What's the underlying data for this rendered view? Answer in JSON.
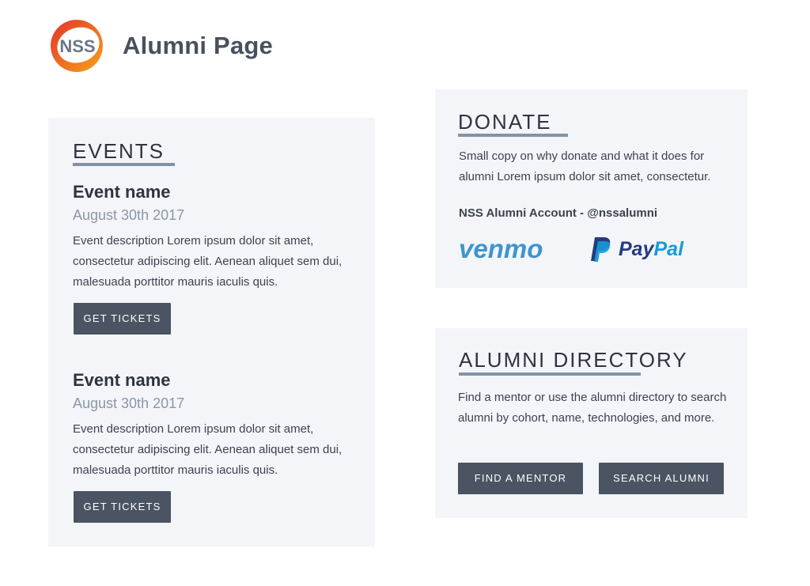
{
  "header": {
    "logo_text": "NSS",
    "title": "Alumni Page"
  },
  "events": {
    "title": "EVENTS",
    "items": [
      {
        "name": "Event name",
        "date": "August 30th 2017",
        "description": "Event description Lorem ipsum dolor sit amet, consectetur adipiscing elit. Aenean aliquet sem dui, malesuada porttitor mauris iaculis quis.",
        "button": "GET TICKETS"
      },
      {
        "name": "Event name",
        "date": "August 30th 2017",
        "description": "Event description Lorem ipsum dolor sit amet, consectetur adipiscing elit. Aenean aliquet sem dui, malesuada porttitor mauris iaculis quis.",
        "button": "GET TICKETS"
      }
    ]
  },
  "donate": {
    "title": "DONATE",
    "copy": "Small copy on why donate and what it does for alumni Lorem ipsum dolor sit amet, consectetur.",
    "account": "NSS Alumni Account - @nssalumni",
    "venmo_label": "venmo",
    "paypal_label_1": "Pay",
    "paypal_label_2": "Pal"
  },
  "directory": {
    "title": "ALUMNI DIRECTORY",
    "copy": "Find a mentor or use the alumni directory to search alumni by cohort, name, technologies, and more.",
    "find_mentor": "FIND A MENTOR",
    "search_alumni": "SEARCH ALUMNI"
  },
  "colors": {
    "card_bg": "#f4f5f8",
    "button_bg": "#4a5462",
    "underline": "#8393a6",
    "venmo_blue": "#3d95ce",
    "paypal_dark": "#253b80",
    "paypal_light": "#179bd7",
    "logo_orange": "#f08a1c",
    "logo_red": "#e2352b"
  }
}
